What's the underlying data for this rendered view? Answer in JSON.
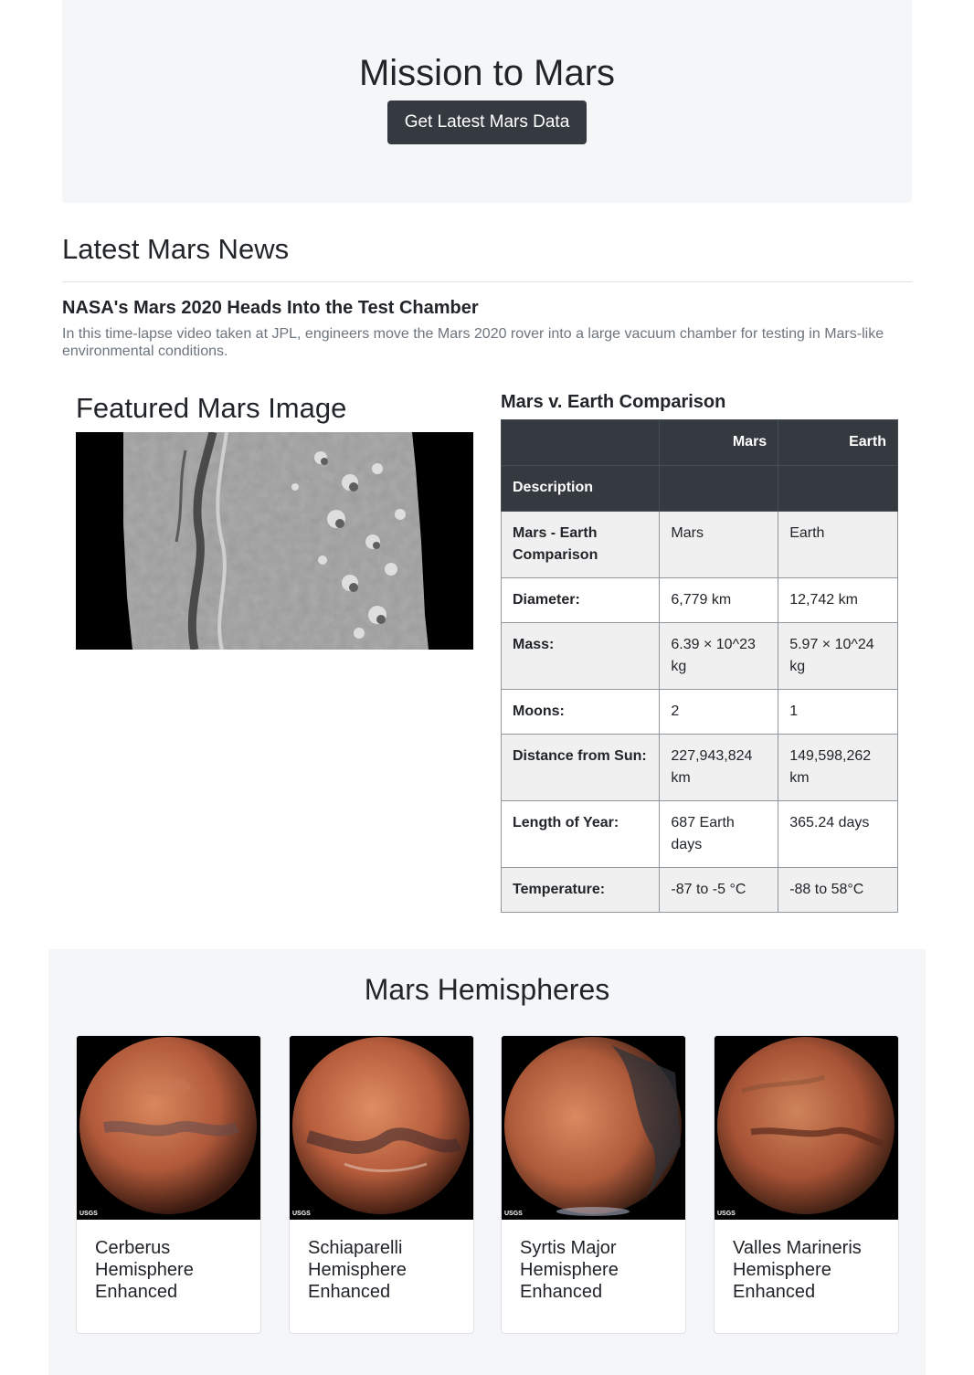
{
  "header": {
    "title": "Mission to Mars",
    "scrape_button_label": "Get Latest Mars Data"
  },
  "news": {
    "heading": "Latest Mars News",
    "title": "NASA's Mars 2020 Heads Into the Test Chamber",
    "teaser": "In this time-lapse video taken at JPL, engineers move the Mars 2020 rover into a large vacuum chamber for testing in Mars-like environmental conditions."
  },
  "featured": {
    "heading": "Featured Mars Image"
  },
  "facts": {
    "heading": "Mars v. Earth Comparison",
    "columns": [
      "Mars",
      "Earth"
    ],
    "index_label": "Description",
    "rows": [
      {
        "label": "Mars - Earth Comparison",
        "mars": "Mars",
        "earth": "Earth"
      },
      {
        "label": "Diameter:",
        "mars": "6,779 km",
        "earth": "12,742 km"
      },
      {
        "label": "Mass:",
        "mars": "6.39 × 10^23 kg",
        "earth": "5.97 × 10^24 kg"
      },
      {
        "label": "Moons:",
        "mars": "2",
        "earth": "1"
      },
      {
        "label": "Distance from Sun:",
        "mars": "227,943,824 km",
        "earth": "149,598,262 km"
      },
      {
        "label": "Length of Year:",
        "mars": "687 Earth days",
        "earth": "365.24 days"
      },
      {
        "label": "Temperature:",
        "mars": "-87 to -5 °C",
        "earth": "-88 to 58°C"
      }
    ]
  },
  "hemispheres": {
    "heading": "Mars Hemispheres",
    "items": [
      {
        "title": "Cerberus Hemisphere Enhanced",
        "watermark": "USGS"
      },
      {
        "title": "Schiaparelli Hemisphere Enhanced",
        "watermark": "USGS"
      },
      {
        "title": "Syrtis Major Hemisphere Enhanced",
        "watermark": "USGS"
      },
      {
        "title": "Valles Marineris Hemisphere Enhanced",
        "watermark": "USGS"
      }
    ]
  }
}
